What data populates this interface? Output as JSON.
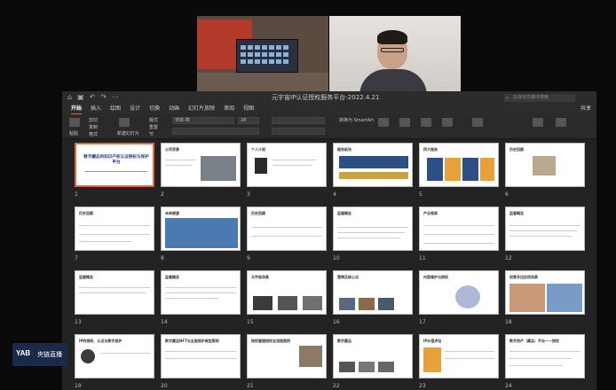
{
  "video_left": {},
  "video_right": {},
  "titlebar": {
    "document_title": "元宇宙IP认证授权服务平台-2022.4.21",
    "search_placeholder": "在演示文稿中搜索"
  },
  "menubar": {
    "items": [
      "开始",
      "插入",
      "绘图",
      "设计",
      "切换",
      "动画",
      "幻灯片放映",
      "审阅",
      "视图"
    ],
    "share_label": "共享"
  },
  "ribbon": {
    "paste": "粘贴",
    "cut": "剪切",
    "copy": "复制",
    "format": "格式",
    "new_slide": "新建幻灯片",
    "layout": "版式",
    "reset": "重置",
    "section": "节",
    "font_name": "宋体-简",
    "font_size": "28",
    "convert_smartart": "转换为 SmartArt"
  },
  "slides": [
    {
      "n": "1",
      "title": "数字藏品的知识产权认证授权与保护平台"
    },
    {
      "n": "2",
      "title": "公司背景"
    },
    {
      "n": "3",
      "title": "个人介绍"
    },
    {
      "n": "4",
      "title": "服务板块"
    },
    {
      "n": "5",
      "title": "四大服务"
    },
    {
      "n": "6",
      "title": "历史回顾"
    },
    {
      "n": "7",
      "title": "历史回顾"
    },
    {
      "n": "8",
      "title": "未来展望"
    },
    {
      "n": "9",
      "title": "历史回顾"
    },
    {
      "n": "10",
      "title": "监管概念"
    },
    {
      "n": "11",
      "title": "产业格局"
    },
    {
      "n": "12",
      "title": "监管概念"
    },
    {
      "n": "13",
      "title": "监管概念"
    },
    {
      "n": "14",
      "title": "监管概念"
    },
    {
      "n": "15",
      "title": "元宇宙场景"
    },
    {
      "n": "16",
      "title": "营销及核心点"
    },
    {
      "n": "17",
      "title": "内容维护与授权"
    },
    {
      "n": "18",
      "title": "创意多边应用场景"
    },
    {
      "n": "19",
      "title": "IP的授权、认证与数字保护"
    },
    {
      "n": "20",
      "title": "数字藏品NFT与全面保护典型案例"
    },
    {
      "n": "21",
      "title": "授权管理授权全流程案例"
    },
    {
      "n": "22",
      "title": "数字藏品"
    },
    {
      "n": "23",
      "title": "IP价值评估"
    },
    {
      "n": "24",
      "title": "数字资产（藏品）平台——授权"
    }
  ],
  "watermark": {
    "mark": "YAB",
    "text": "央链直播"
  },
  "colors": {
    "accent": "#e0673e",
    "cover_title": "#1d3c85"
  }
}
